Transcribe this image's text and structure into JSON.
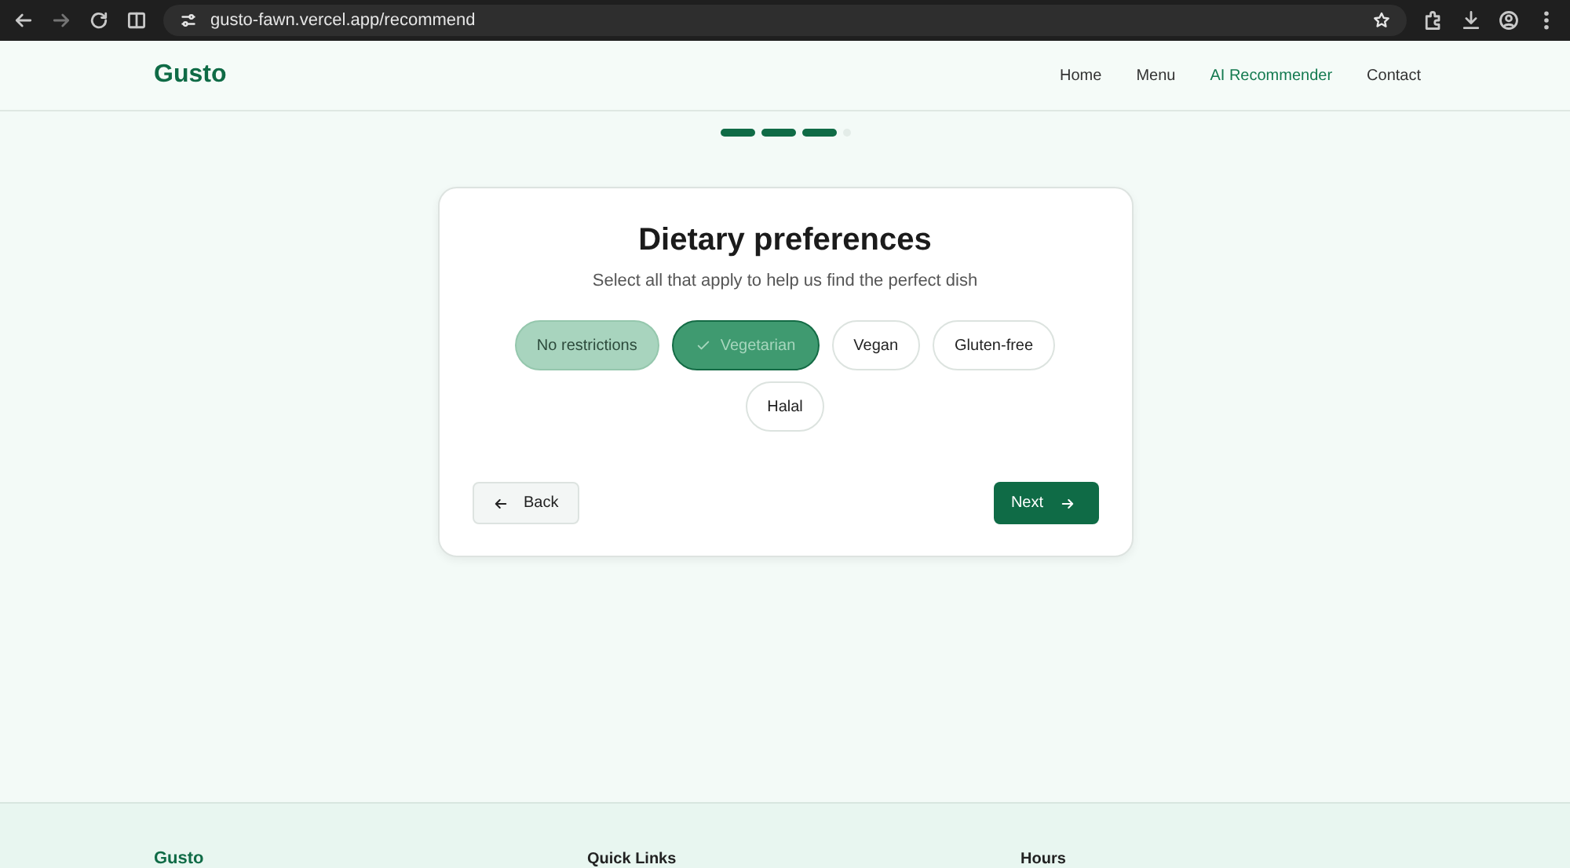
{
  "browser": {
    "url": "gusto-fawn.vercel.app/recommend"
  },
  "nav": {
    "logo": "Gusto",
    "links": [
      {
        "label": "Home",
        "selected": false
      },
      {
        "label": "Menu",
        "selected": false
      },
      {
        "label": "AI Recommender",
        "selected": true
      },
      {
        "label": "Contact",
        "selected": false
      }
    ]
  },
  "progress": [
    {
      "complete": true
    },
    {
      "complete": true
    },
    {
      "complete": true
    },
    {
      "complete": false
    }
  ],
  "card": {
    "title": "Dietary preferences",
    "subtitle": "Select all that apply to help us find the perfect dish",
    "options": [
      {
        "label": "No restrictions",
        "selected": false,
        "highlighted": true
      },
      {
        "label": "Vegetarian",
        "selected": true,
        "highlighted": false
      },
      {
        "label": "Vegan",
        "selected": false,
        "highlighted": false
      },
      {
        "label": "Gluten-free",
        "selected": false,
        "highlighted": false
      },
      {
        "label": "Halal",
        "selected": false,
        "highlighted": false
      }
    ],
    "back": "Back",
    "next": "Next"
  },
  "footer": {
    "logo": "Gusto",
    "headings": [
      "Quick Links",
      "Hours"
    ]
  }
}
